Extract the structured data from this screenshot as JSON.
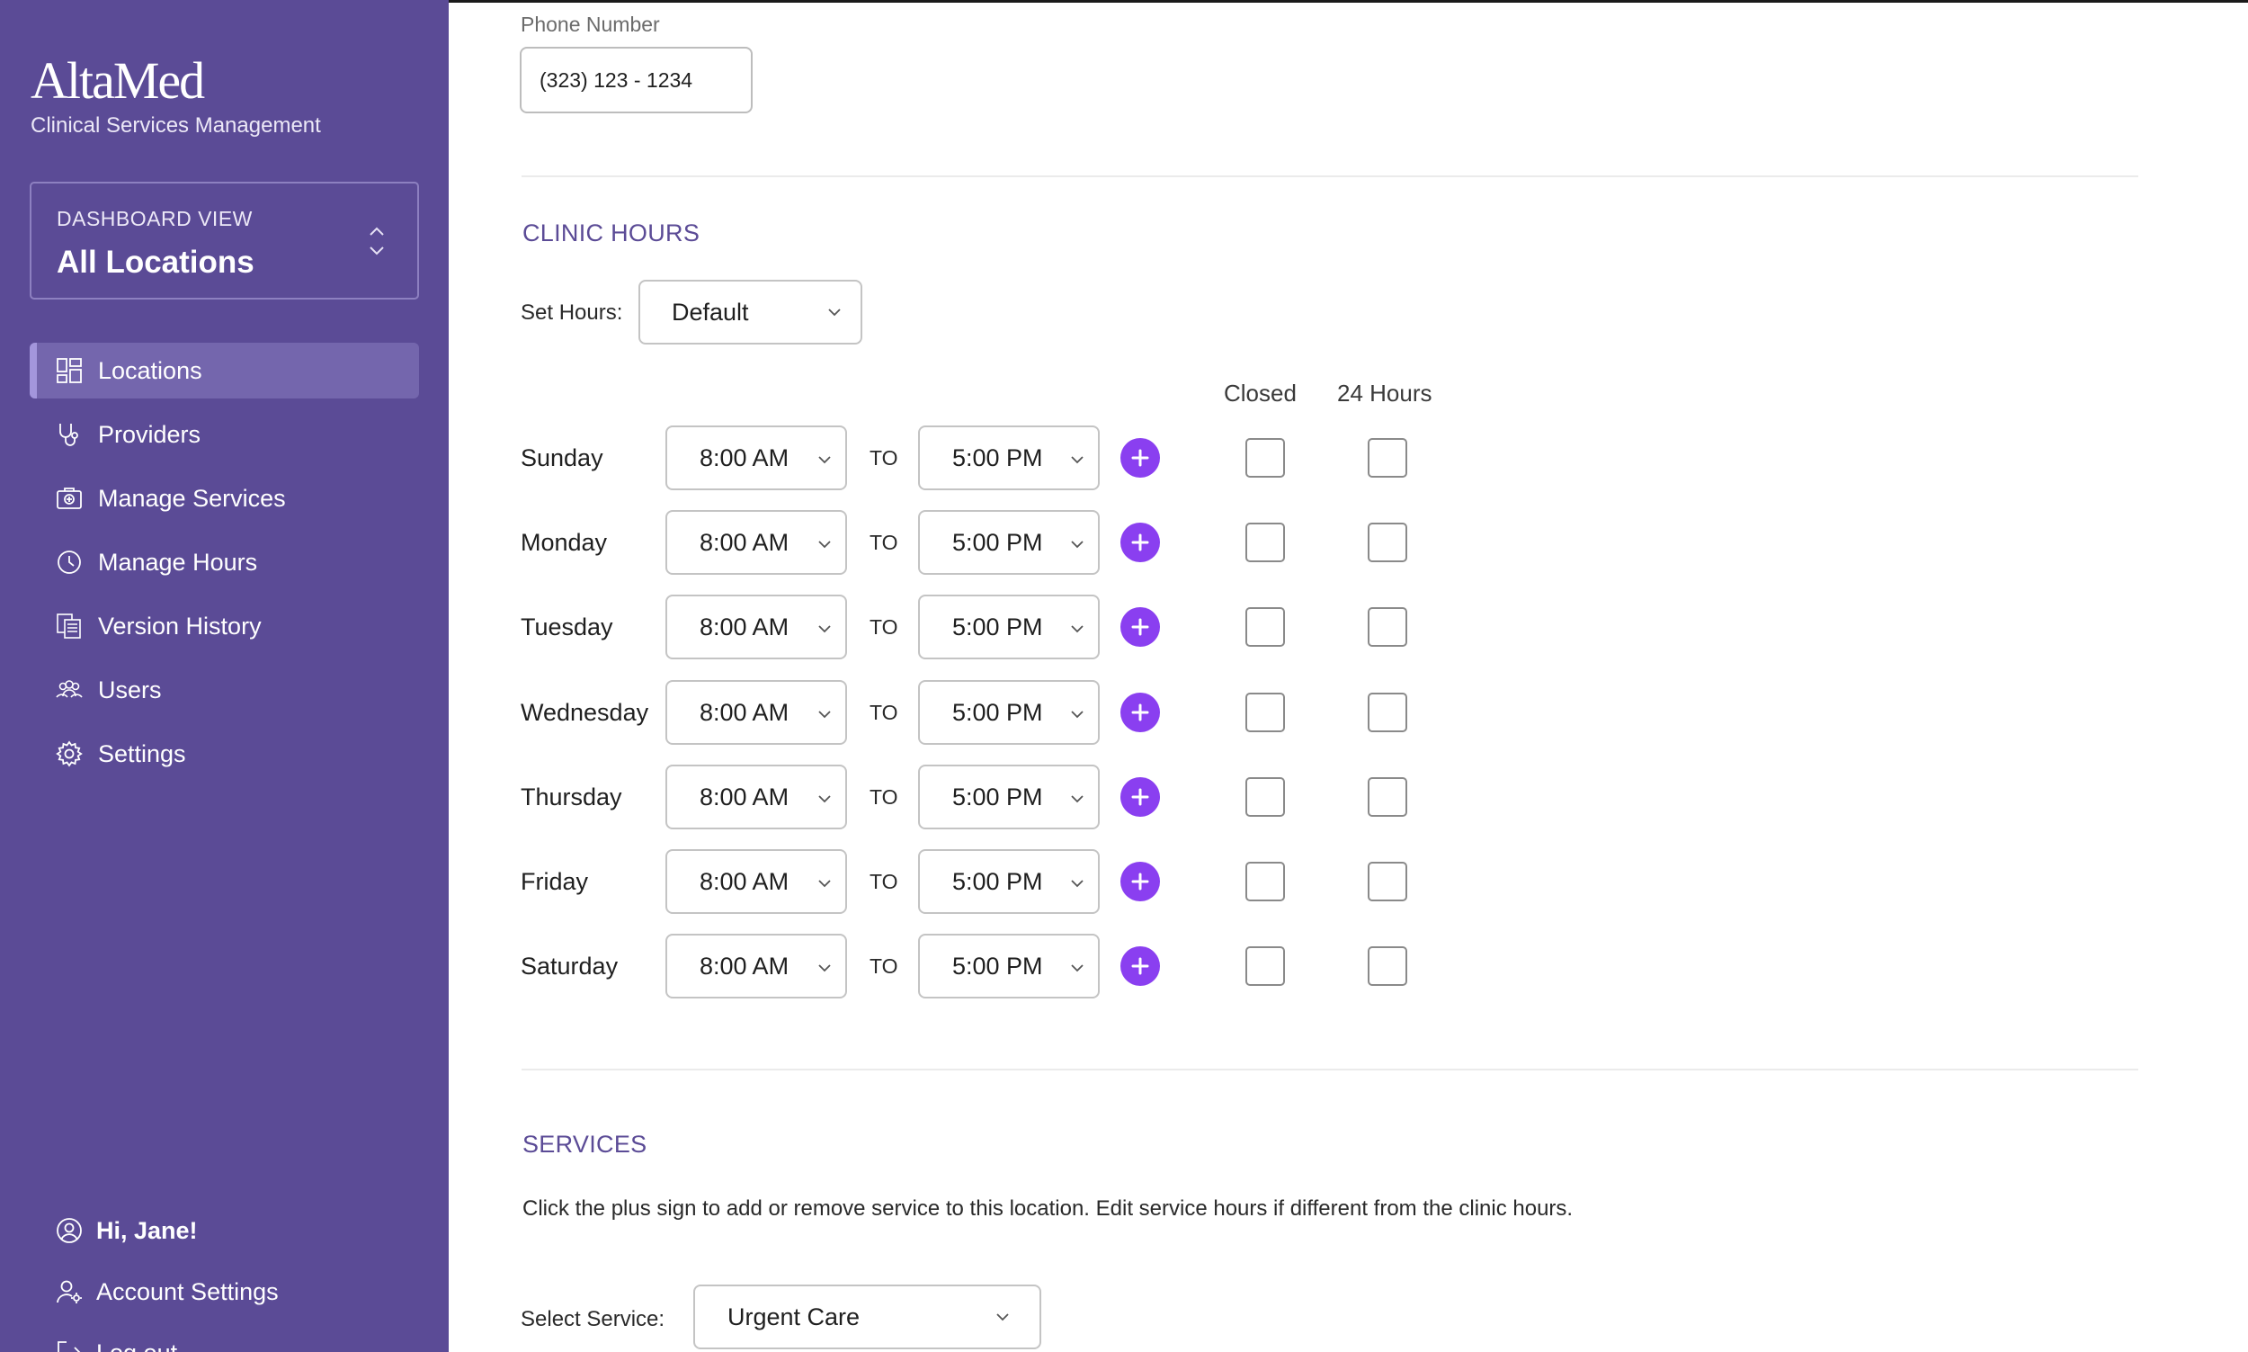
{
  "sidebar": {
    "logo": "AltaMed",
    "subtitle": "Clinical Services Management",
    "dashboard": {
      "label": "DASHBOARD VIEW",
      "value": "All Locations"
    },
    "nav": [
      {
        "label": "Locations",
        "icon": "grid-icon",
        "active": true
      },
      {
        "label": "Providers",
        "icon": "stethoscope-icon"
      },
      {
        "label": "Manage Services",
        "icon": "medical-bag-icon"
      },
      {
        "label": "Manage Hours",
        "icon": "clock-icon"
      },
      {
        "label": "Version History",
        "icon": "documents-icon"
      },
      {
        "label": "Users",
        "icon": "users-icon"
      },
      {
        "label": "Settings",
        "icon": "gear-icon"
      }
    ],
    "user": {
      "greeting": "Hi, Jane!",
      "account_settings": "Account Settings",
      "logout": "Log out"
    }
  },
  "contact": {
    "phone_label": "Phone Number",
    "phone_value": "(323) 123 - 1234"
  },
  "clinic_hours": {
    "title": "CLINIC HOURS",
    "set_hours_label": "Set Hours:",
    "set_hours_value": "Default",
    "closed_header": "Closed",
    "hours24_header": "24 Hours",
    "to_label": "TO",
    "days": [
      {
        "day": "Sunday",
        "open": "8:00 AM",
        "close": "5:00 PM",
        "closed": false,
        "all_day": false
      },
      {
        "day": "Monday",
        "open": "8:00 AM",
        "close": "5:00 PM",
        "closed": false,
        "all_day": false
      },
      {
        "day": "Tuesday",
        "open": "8:00 AM",
        "close": "5:00 PM",
        "closed": false,
        "all_day": false
      },
      {
        "day": "Wednesday",
        "open": "8:00 AM",
        "close": "5:00 PM",
        "closed": false,
        "all_day": false
      },
      {
        "day": "Thursday",
        "open": "8:00 AM",
        "close": "5:00 PM",
        "closed": false,
        "all_day": false
      },
      {
        "day": "Friday",
        "open": "8:00 AM",
        "close": "5:00 PM",
        "closed": false,
        "all_day": false
      },
      {
        "day": "Saturday",
        "open": "8:00 AM",
        "close": "5:00 PM",
        "closed": false,
        "all_day": false
      }
    ]
  },
  "services": {
    "title": "SERVICES",
    "help_text": "Click the plus sign to add or remove service to this location. Edit service hours if different from the clinic hours.",
    "select_label": "Select Service:",
    "select_value": "Urgent Care"
  },
  "colors": {
    "sidebar": "#5b4b96",
    "accent": "#8a3ff0",
    "section_title": "#5b4b96"
  }
}
